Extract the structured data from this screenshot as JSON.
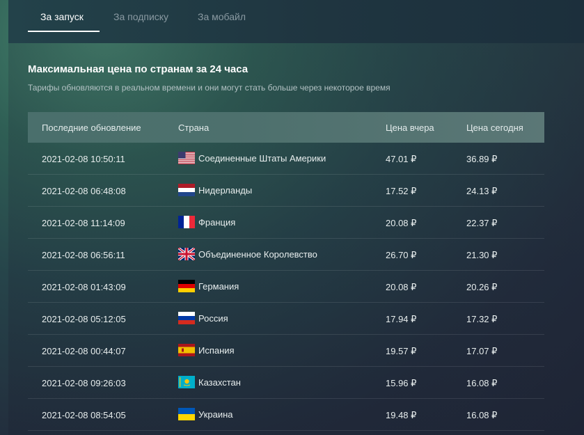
{
  "tabs": [
    {
      "label": "За запуск",
      "active": true
    },
    {
      "label": "За подписку",
      "active": false
    },
    {
      "label": "За мобайл",
      "active": false
    }
  ],
  "section": {
    "title": "Максимальная цена по странам за 24 часа",
    "subtitle": "Тарифы обновляются в реальном времени и они могут стать больше через некоторое время"
  },
  "table": {
    "headers": [
      "Последние обновление",
      "Страна",
      "Цена вчера",
      "Цена сегодня"
    ],
    "rows": [
      {
        "updated": "2021-02-08 10:50:11",
        "country": "Соединенные Штаты Америки",
        "flag": "us-flag-icon",
        "yesterday": "47.01 ₽",
        "today": "36.89 ₽"
      },
      {
        "updated": "2021-02-08 06:48:08",
        "country": "Нидерланды",
        "flag": "nl-flag-icon",
        "yesterday": "17.52 ₽",
        "today": "24.13 ₽"
      },
      {
        "updated": "2021-02-08 11:14:09",
        "country": "Франция",
        "flag": "fr-flag-icon",
        "yesterday": "20.08 ₽",
        "today": "22.37 ₽"
      },
      {
        "updated": "2021-02-08 06:56:11",
        "country": "Объединенное Королевство",
        "flag": "gb-flag-icon",
        "yesterday": "26.70 ₽",
        "today": "21.30 ₽"
      },
      {
        "updated": "2021-02-08 01:43:09",
        "country": "Германия",
        "flag": "de-flag-icon",
        "yesterday": "20.08 ₽",
        "today": "20.26 ₽"
      },
      {
        "updated": "2021-02-08 05:12:05",
        "country": "Россия",
        "flag": "ru-flag-icon",
        "yesterday": "17.94 ₽",
        "today": "17.32 ₽"
      },
      {
        "updated": "2021-02-08 00:44:07",
        "country": "Испания",
        "flag": "es-flag-icon",
        "yesterday": "19.57 ₽",
        "today": "17.07 ₽"
      },
      {
        "updated": "2021-02-08 09:26:03",
        "country": "Казахстан",
        "flag": "kz-flag-icon",
        "yesterday": "15.96 ₽",
        "today": "16.08 ₽"
      },
      {
        "updated": "2021-02-08 08:54:05",
        "country": "Украина",
        "flag": "ua-flag-icon",
        "yesterday": "19.48 ₽",
        "today": "16.08 ₽"
      }
    ]
  }
}
